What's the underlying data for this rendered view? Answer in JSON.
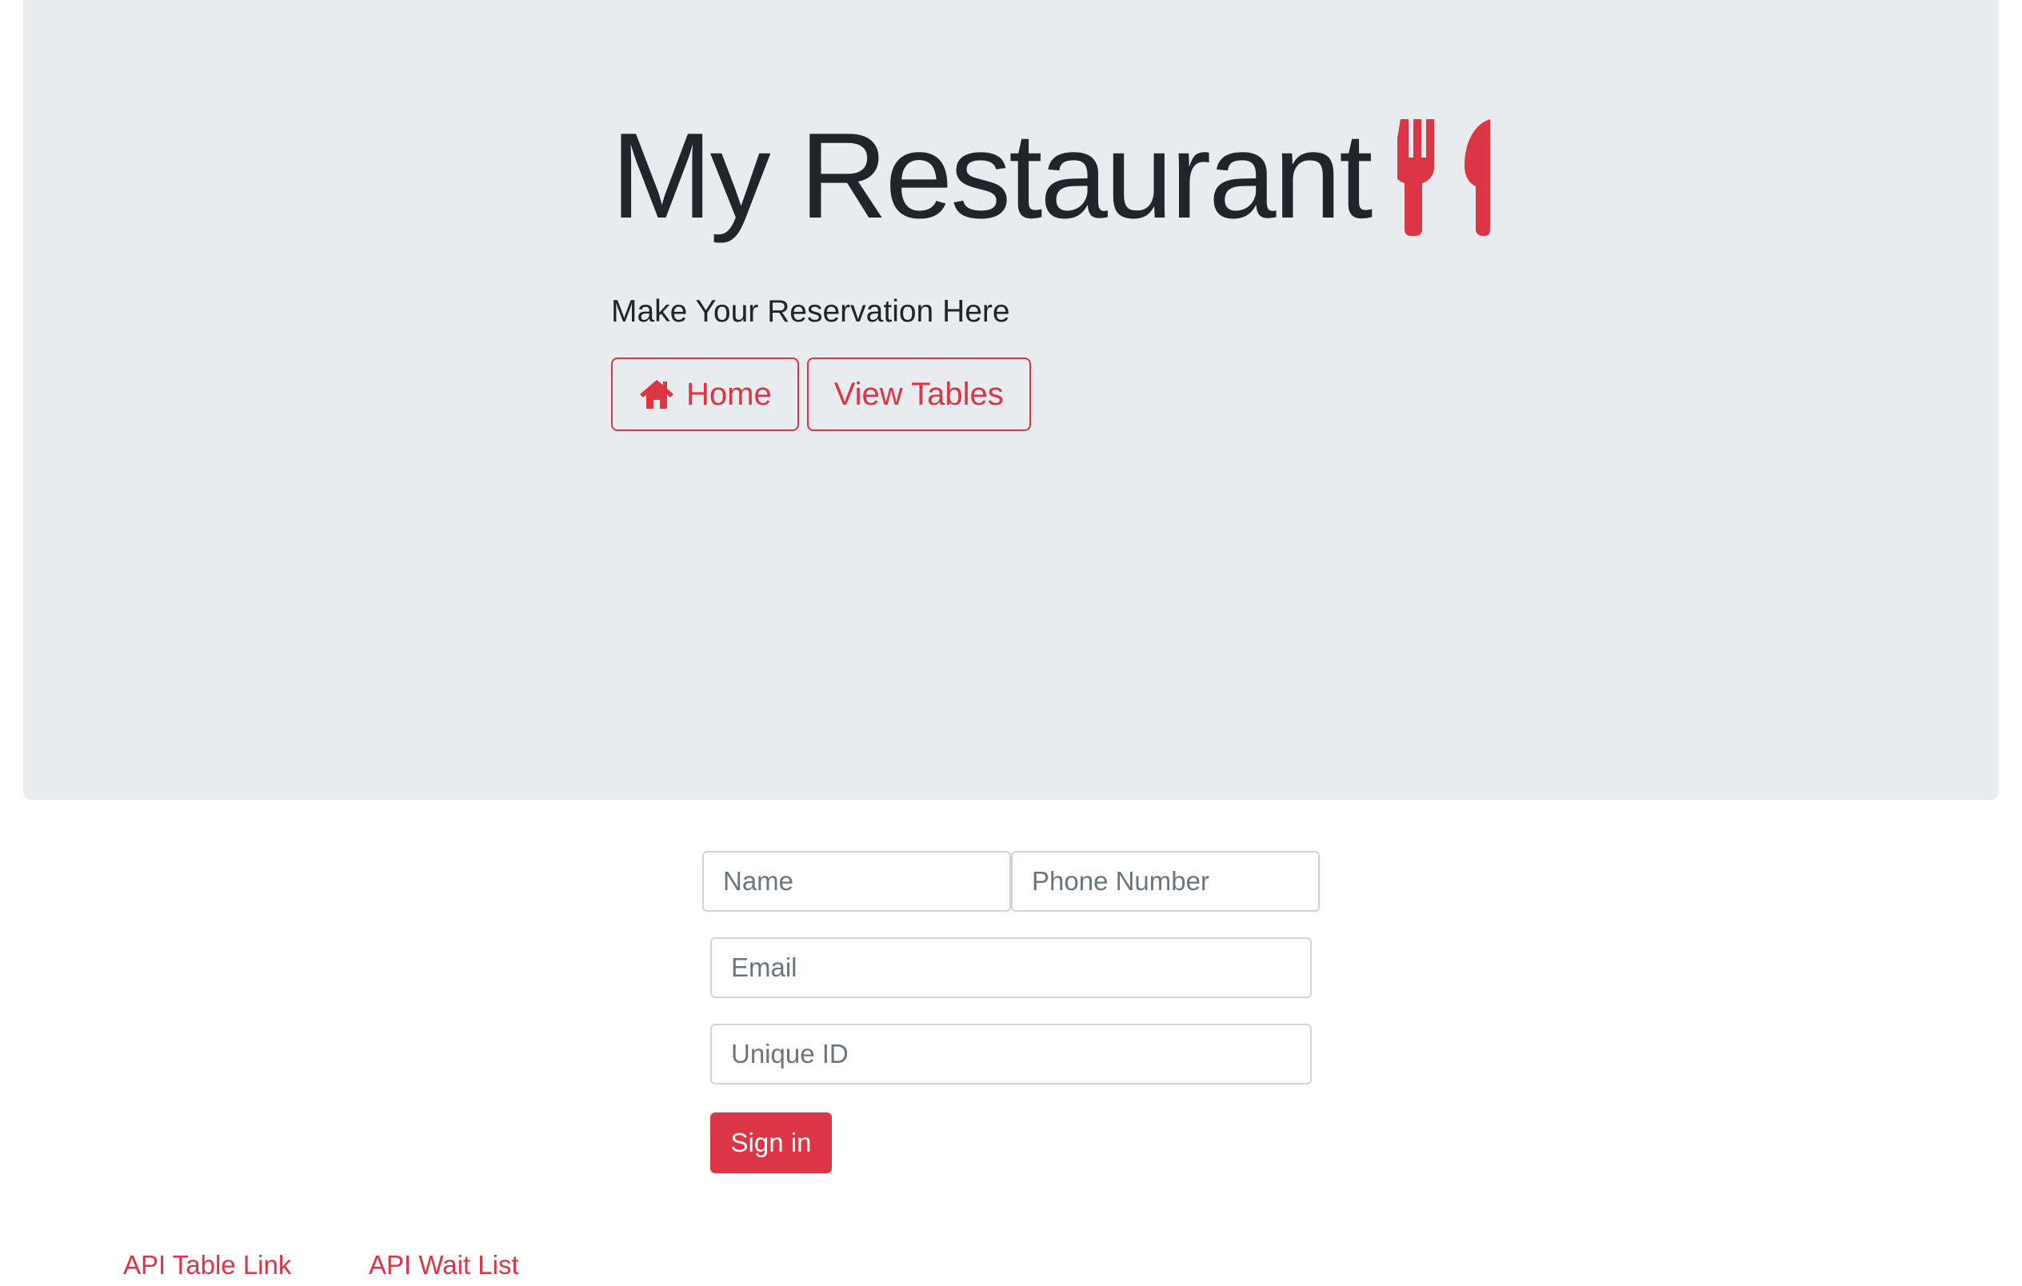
{
  "header": {
    "title": "My Restaurant",
    "title_icon": "utensils-icon",
    "subtitle": "Make Your Reservation Here",
    "buttons": [
      {
        "label": "Home",
        "icon": "home-icon"
      },
      {
        "label": "View Tables"
      }
    ]
  },
  "form": {
    "name_placeholder": "Name",
    "phone_placeholder": "Phone Number",
    "email_placeholder": "Email",
    "id_placeholder": "Unique ID",
    "submit_label": "Sign in"
  },
  "footer": {
    "links": [
      {
        "label": "API Table Link"
      },
      {
        "label": "API Wait List"
      }
    ]
  },
  "colors": {
    "accent": "#dc3545",
    "jumbotron_bg": "#e9ecef",
    "text": "#212529"
  }
}
